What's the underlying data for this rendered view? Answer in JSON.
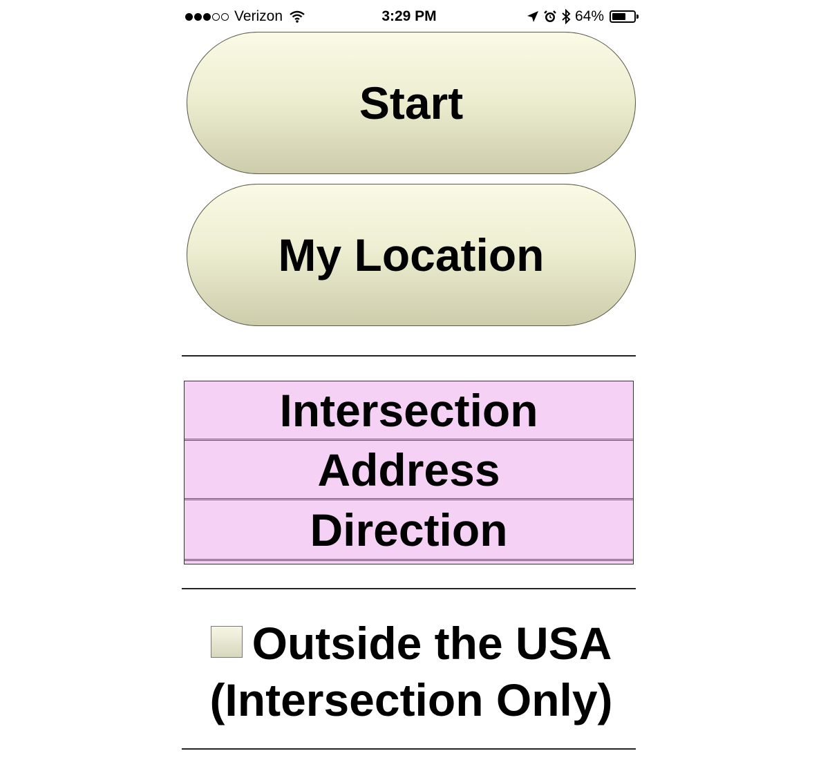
{
  "status_bar": {
    "carrier": "Verizon",
    "signal_bars_filled": 3,
    "signal_bars_total": 5,
    "time": "3:29 PM",
    "battery_percent": "64%",
    "battery_level": 0.64,
    "icons": [
      "wifi-icon",
      "location-arrow-icon",
      "alarm-icon",
      "bluetooth-icon",
      "battery-icon"
    ]
  },
  "buttons": {
    "start_label": "Start",
    "my_location_label": "My Location"
  },
  "options": {
    "items": [
      {
        "label": "Intersection"
      },
      {
        "label": "Address"
      },
      {
        "label": "Direction"
      }
    ]
  },
  "outside_usa": {
    "label": "Outside the USA",
    "sublabel": "(Intersection Only)",
    "checked": false
  },
  "colors": {
    "button_gradient_top": "#fafae6",
    "button_gradient_bottom": "#cdcdac",
    "option_background": "#f6d1f6"
  }
}
